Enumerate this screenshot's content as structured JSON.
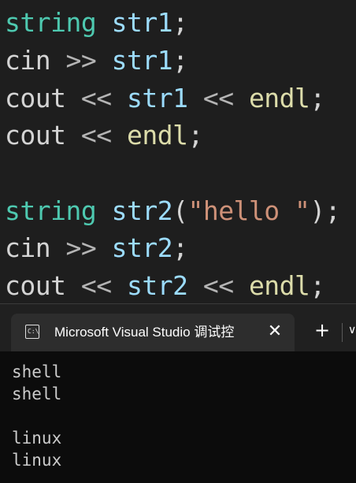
{
  "editor": {
    "lines": [
      [
        {
          "t": "string",
          "c": "kw-type"
        },
        {
          "t": " ",
          "c": "plain"
        },
        {
          "t": "str1",
          "c": "kw-var"
        },
        {
          "t": ";",
          "c": "plain"
        }
      ],
      [
        {
          "t": "cin",
          "c": "plain"
        },
        {
          "t": " >> ",
          "c": "op"
        },
        {
          "t": "str1",
          "c": "kw-var"
        },
        {
          "t": ";",
          "c": "plain"
        }
      ],
      [
        {
          "t": "cout",
          "c": "plain"
        },
        {
          "t": " << ",
          "c": "op"
        },
        {
          "t": "str1",
          "c": "kw-var"
        },
        {
          "t": " << ",
          "c": "op"
        },
        {
          "t": "endl",
          "c": "kw-fn"
        },
        {
          "t": ";",
          "c": "plain"
        }
      ],
      [
        {
          "t": "cout",
          "c": "plain"
        },
        {
          "t": " << ",
          "c": "op"
        },
        {
          "t": "endl",
          "c": "kw-fn"
        },
        {
          "t": ";",
          "c": "plain"
        }
      ],
      [],
      [
        {
          "t": "string",
          "c": "kw-type"
        },
        {
          "t": " ",
          "c": "plain"
        },
        {
          "t": "str2",
          "c": "kw-var"
        },
        {
          "t": "(",
          "c": "plain"
        },
        {
          "t": "\"hello \"",
          "c": "kw-str"
        },
        {
          "t": ");",
          "c": "plain"
        }
      ],
      [
        {
          "t": "cin",
          "c": "plain"
        },
        {
          "t": " >> ",
          "c": "op"
        },
        {
          "t": "str2",
          "c": "kw-var"
        },
        {
          "t": ";",
          "c": "plain"
        }
      ],
      [
        {
          "t": "cout",
          "c": "plain"
        },
        {
          "t": " << ",
          "c": "op"
        },
        {
          "t": "str2",
          "c": "kw-var"
        },
        {
          "t": " << ",
          "c": "op"
        },
        {
          "t": "endl",
          "c": "kw-fn"
        },
        {
          "t": ";",
          "c": "plain"
        }
      ]
    ]
  },
  "terminal": {
    "tab_icon_text": "C:\\",
    "tab_title": "Microsoft Visual Studio 调试控",
    "close_glyph": "✕",
    "new_tab_glyph": "+",
    "dropdown_glyph": "∨",
    "output": [
      "shell",
      "shell",
      "",
      "linux",
      "linux"
    ]
  }
}
